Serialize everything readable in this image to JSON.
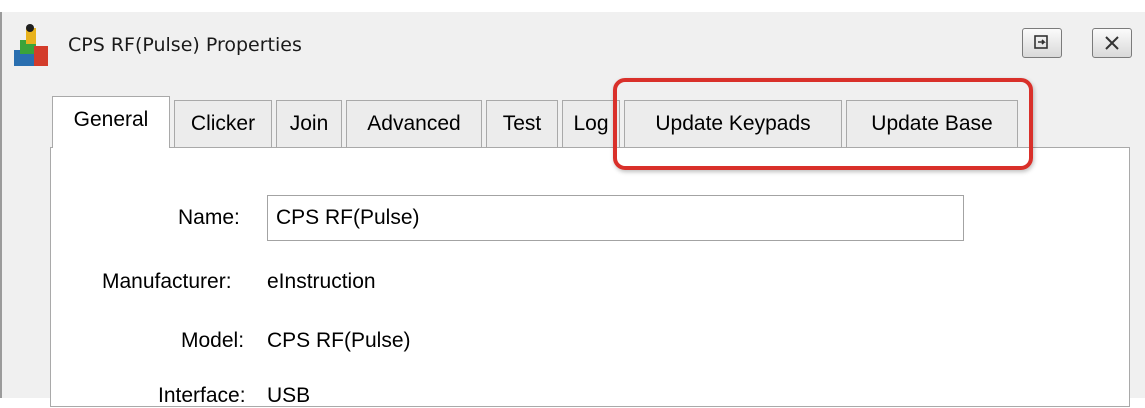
{
  "window": {
    "title": "CPS RF(Pulse) Properties",
    "app_icon": "app-logo-icon",
    "restore_icon": "restore-icon",
    "close_icon": "close-icon"
  },
  "tabs": [
    {
      "label": "General",
      "active": true
    },
    {
      "label": "Clicker",
      "active": false
    },
    {
      "label": "Join",
      "active": false
    },
    {
      "label": "Advanced",
      "active": false
    },
    {
      "label": "Test",
      "active": false
    },
    {
      "label": "Log",
      "active": false
    },
    {
      "label": "Update Keypads",
      "active": false
    },
    {
      "label": "Update Base",
      "active": false
    }
  ],
  "fields": {
    "name_label": "Name:",
    "name_value": "CPS RF(Pulse)",
    "manufacturer_label": "Manufacturer:",
    "manufacturer_value": "eInstruction",
    "model_label": "Model:",
    "model_value": "CPS RF(Pulse)",
    "interface_label": "Interface:",
    "interface_value": "USB"
  },
  "annotation": {
    "color": "#d9302a"
  }
}
